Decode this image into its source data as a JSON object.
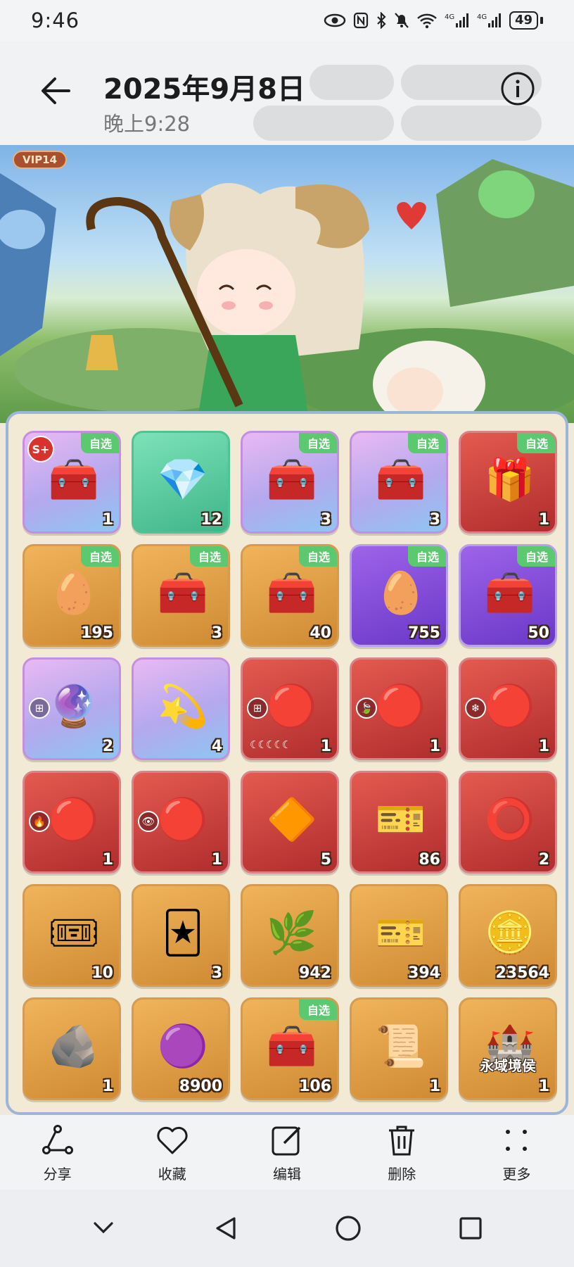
{
  "status_bar": {
    "time": "9:46",
    "battery": "49",
    "icons": [
      "eye-icon",
      "nfc-icon",
      "bluetooth-icon",
      "mute-icon",
      "wifi-icon",
      "signal-4g-icon",
      "signal-4g-icon-2"
    ]
  },
  "header": {
    "date": "2025年9月8日",
    "time": "晚上9:28"
  },
  "banner": {
    "vip": "VIP14"
  },
  "items": [
    {
      "count": "1",
      "tag": "自选",
      "rank": "S+",
      "style": "purple",
      "icon": "🧰"
    },
    {
      "count": "12",
      "tag": "",
      "rank": "",
      "style": "green",
      "icon": "💎"
    },
    {
      "count": "3",
      "tag": "自选",
      "rank": "",
      "style": "purple",
      "icon": "🧰"
    },
    {
      "count": "3",
      "tag": "自选",
      "rank": "",
      "style": "purple",
      "icon": "🧰"
    },
    {
      "count": "1",
      "tag": "自选",
      "rank": "",
      "style": "red",
      "icon": "🎁"
    },
    {
      "count": "195",
      "tag": "自选",
      "rank": "",
      "style": "orange",
      "icon": "🥚"
    },
    {
      "count": "3",
      "tag": "自选",
      "rank": "",
      "style": "orange",
      "icon": "🧰"
    },
    {
      "count": "40",
      "tag": "自选",
      "rank": "",
      "style": "orange",
      "icon": "🧰"
    },
    {
      "count": "755",
      "tag": "自选",
      "rank": "",
      "style": "violet",
      "icon": "🥚"
    },
    {
      "count": "50",
      "tag": "自选",
      "rank": "",
      "style": "violet",
      "icon": "🧰"
    },
    {
      "count": "2",
      "tag": "",
      "rank": "",
      "style": "purple",
      "icon": "🔮",
      "element": "⊞"
    },
    {
      "count": "4",
      "tag": "",
      "rank": "",
      "style": "purple",
      "icon": "💫"
    },
    {
      "count": "1",
      "tag": "",
      "rank": "",
      "style": "red",
      "icon": "🔴",
      "element": "⊞",
      "stars": "☾☾☾☾☾"
    },
    {
      "count": "1",
      "tag": "",
      "rank": "",
      "style": "red",
      "icon": "🔴",
      "element": "🍃"
    },
    {
      "count": "1",
      "tag": "",
      "rank": "",
      "style": "red",
      "icon": "🔴",
      "element": "❄"
    },
    {
      "count": "1",
      "tag": "",
      "rank": "",
      "style": "red",
      "icon": "🔴",
      "element": "🔥"
    },
    {
      "count": "1",
      "tag": "",
      "rank": "",
      "style": "red",
      "icon": "🔴",
      "element": "👁"
    },
    {
      "count": "5",
      "tag": "",
      "rank": "",
      "style": "red",
      "icon": "🔶"
    },
    {
      "count": "86",
      "tag": "",
      "rank": "",
      "style": "red",
      "icon": "🎫"
    },
    {
      "count": "2",
      "tag": "",
      "rank": "",
      "style": "red",
      "icon": "⭕"
    },
    {
      "count": "10",
      "tag": "",
      "rank": "",
      "style": "orange",
      "icon": "🎟"
    },
    {
      "count": "3",
      "tag": "",
      "rank": "",
      "style": "orange",
      "icon": "🃏"
    },
    {
      "count": "942",
      "tag": "",
      "rank": "",
      "style": "orange",
      "icon": "🌿"
    },
    {
      "count": "394",
      "tag": "",
      "rank": "",
      "style": "orange",
      "icon": "🎫"
    },
    {
      "count": "23564",
      "tag": "",
      "rank": "",
      "style": "orange",
      "icon": "🪙"
    },
    {
      "count": "1",
      "tag": "",
      "rank": "",
      "style": "orange",
      "icon": "🪨"
    },
    {
      "count": "8900",
      "tag": "",
      "rank": "",
      "style": "orange",
      "icon": "🟣"
    },
    {
      "count": "106",
      "tag": "自选",
      "rank": "",
      "style": "orange",
      "icon": "🧰"
    },
    {
      "count": "1",
      "tag": "",
      "rank": "",
      "style": "orange",
      "icon": "📜"
    },
    {
      "count": "1",
      "tag": "",
      "rank": "",
      "style": "orange",
      "icon": "🏰",
      "caption": "永域境侯"
    }
  ],
  "actions": [
    {
      "label": "分享",
      "icon": "share-icon"
    },
    {
      "label": "收藏",
      "icon": "heart-icon"
    },
    {
      "label": "编辑",
      "icon": "edit-icon"
    },
    {
      "label": "删除",
      "icon": "trash-icon"
    },
    {
      "label": "更多",
      "icon": "more-icon"
    }
  ],
  "nav": [
    "collapse-icon",
    "back-triangle-icon",
    "home-circle-icon",
    "recents-square-icon"
  ]
}
